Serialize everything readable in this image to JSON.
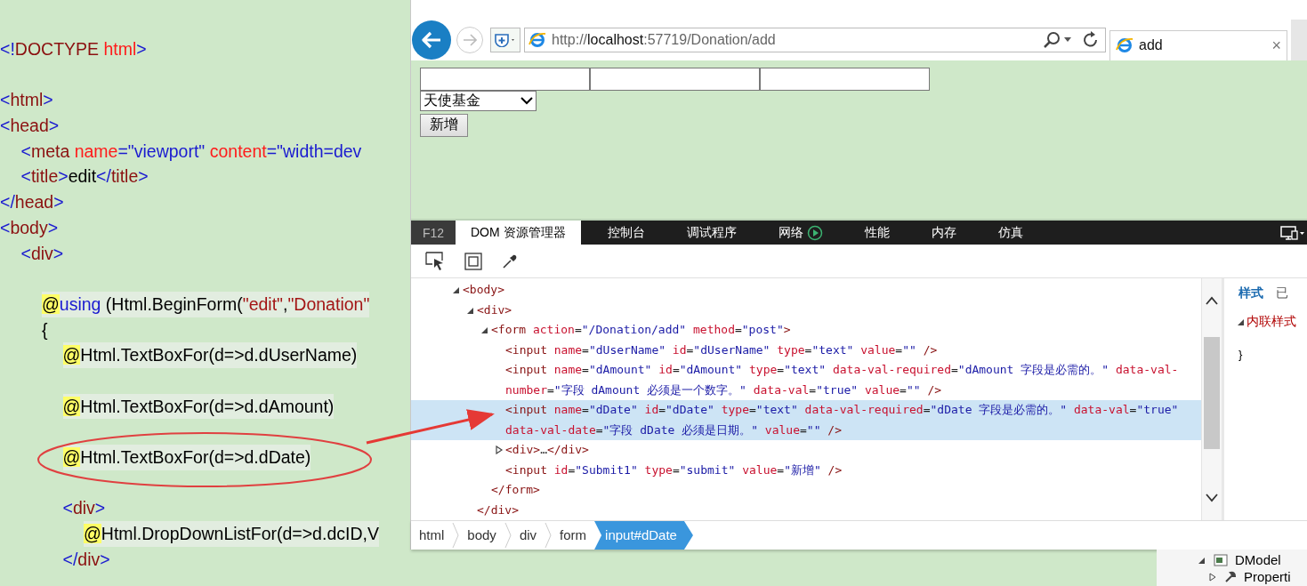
{
  "editor": {
    "lines": [
      {
        "after_blank": false,
        "highlighted": false,
        "tokens": [
          {
            "kind": "punct",
            "text": "<!"
          },
          {
            "kind": "tag",
            "text": "DOCTYPE "
          },
          {
            "kind": "attr",
            "text": "html"
          },
          {
            "kind": "punct",
            "text": ">"
          }
        ]
      },
      {
        "after_blank": true,
        "highlighted": false,
        "tokens": [
          {
            "kind": "punct",
            "text": "<"
          },
          {
            "kind": "tag",
            "text": "html"
          },
          {
            "kind": "punct",
            "text": ">"
          }
        ]
      },
      {
        "after_blank": false,
        "highlighted": false,
        "tokens": [
          {
            "kind": "punct",
            "text": "<"
          },
          {
            "kind": "tag",
            "text": "head"
          },
          {
            "kind": "punct",
            "text": ">"
          }
        ],
        "children": [
          {
            "after_blank": false,
            "highlighted": false,
            "tokens": [
              {
                "kind": "punct",
                "text": "<"
              },
              {
                "kind": "tag",
                "text": "meta "
              },
              {
                "kind": "attr",
                "text": "name"
              },
              {
                "kind": "punct",
                "text": "=\"viewport\" "
              },
              {
                "kind": "attr",
                "text": "content"
              },
              {
                "kind": "punct",
                "text": "=\"width=dev"
              }
            ]
          },
          {
            "after_blank": false,
            "highlighted": false,
            "tokens": [
              {
                "kind": "punct",
                "text": "<"
              },
              {
                "kind": "tag",
                "text": "title"
              },
              {
                "kind": "punct",
                "text": ">"
              },
              {
                "kind": "text",
                "text": "edit"
              },
              {
                "kind": "punct",
                "text": "</"
              },
              {
                "kind": "tag",
                "text": "title"
              },
              {
                "kind": "punct",
                "text": ">"
              }
            ]
          }
        ]
      },
      {
        "after_blank": false,
        "highlighted": false,
        "tokens": [
          {
            "kind": "punct",
            "text": "</"
          },
          {
            "kind": "tag",
            "text": "head"
          },
          {
            "kind": "punct",
            "text": ">"
          }
        ]
      },
      {
        "after_blank": false,
        "highlighted": false,
        "tokens": [
          {
            "kind": "punct",
            "text": "<"
          },
          {
            "kind": "tag",
            "text": "body"
          },
          {
            "kind": "punct",
            "text": ">"
          }
        ],
        "children": [
          {
            "after_blank": false,
            "highlighted": false,
            "tokens": [
              {
                "kind": "punct",
                "text": "<"
              },
              {
                "kind": "tag",
                "text": "div"
              },
              {
                "kind": "punct",
                "text": ">"
              }
            ],
            "children": [
              {
                "after_blank": true,
                "highlighted": true,
                "tokens": [
                  {
                    "kind": "razor",
                    "text": "@"
                  },
                  {
                    "kind": "keyword",
                    "text": "using"
                  },
                  {
                    "kind": "text",
                    "text": " (Html.BeginForm("
                  },
                  {
                    "kind": "string",
                    "text": "\"edit\""
                  },
                  {
                    "kind": "text",
                    "text": ","
                  },
                  {
                    "kind": "string",
                    "text": "\"Donation\""
                  }
                ]
              },
              {
                "after_blank": false,
                "highlighted": false,
                "tokens": [
                  {
                    "kind": "text",
                    "text": "{"
                  }
                ],
                "children": [
                  {
                    "after_blank": false,
                    "highlighted": true,
                    "tokens": [
                      {
                        "kind": "razor",
                        "text": "@"
                      },
                      {
                        "kind": "text",
                        "text": "Html.TextBoxFor(d=>d.dUserName)"
                      }
                    ]
                  },
                  {
                    "after_blank": true,
                    "highlighted": true,
                    "tokens": [
                      {
                        "kind": "razor",
                        "text": "@"
                      },
                      {
                        "kind": "text",
                        "text": "Html.TextBoxFor(d=>d.dAmount)"
                      }
                    ]
                  },
                  {
                    "after_blank": true,
                    "highlighted": true,
                    "tokens": [
                      {
                        "kind": "razor",
                        "text": "@"
                      },
                      {
                        "kind": "text",
                        "text": "Html.TextBoxFor(d=>d.dDate)"
                      }
                    ]
                  },
                  {
                    "after_blank": true,
                    "highlighted": false,
                    "tokens": [
                      {
                        "kind": "punct",
                        "text": "<"
                      },
                      {
                        "kind": "tag",
                        "text": "div"
                      },
                      {
                        "kind": "punct",
                        "text": ">"
                      }
                    ],
                    "children": [
                      {
                        "after_blank": false,
                        "highlighted": true,
                        "tokens": [
                          {
                            "kind": "razor",
                            "text": "@"
                          },
                          {
                            "kind": "text",
                            "text": "Html.DropDownListFor(d=>d.dcID,V"
                          }
                        ]
                      }
                    ]
                  },
                  {
                    "after_blank": false,
                    "highlighted": false,
                    "tokens": [
                      {
                        "kind": "punct",
                        "text": "</"
                      },
                      {
                        "kind": "tag",
                        "text": "div"
                      },
                      {
                        "kind": "punct",
                        "text": ">"
                      }
                    ]
                  }
                ]
              }
            ]
          }
        ]
      }
    ]
  },
  "browser": {
    "address": {
      "scheme": "http://",
      "host": "localhost",
      "path": ":57719/Donation/add"
    },
    "tab": {
      "title": "add",
      "close": "×"
    },
    "page": {
      "text_fields": [
        {
          "kind": "text"
        },
        {
          "kind": "text"
        },
        {
          "kind": "text"
        }
      ],
      "dropdown": {
        "value": "天使基金"
      },
      "submit_button": "新增"
    }
  },
  "devtools": {
    "f12_label": "F12",
    "tabs": [
      {
        "label": "DOM 资源管理器",
        "selected": true
      },
      {
        "label": "控制台",
        "selected": false
      },
      {
        "label": "调试程序",
        "selected": false
      },
      {
        "label": "网络",
        "selected": false,
        "kind": "network"
      },
      {
        "label": "性能",
        "selected": false
      },
      {
        "label": "内存",
        "selected": false
      },
      {
        "label": "仿真",
        "selected": false
      }
    ],
    "dom_tree": [
      {
        "expanded": true,
        "selected": false,
        "tokens": [
          {
            "kind": "tag",
            "text": "<body>"
          }
        ],
        "children": [
          {
            "expanded": true,
            "selected": false,
            "tokens": [
              {
                "kind": "tag",
                "text": "<div>"
              }
            ],
            "end_tokens": [
              {
                "kind": "tag",
                "text": "</div>"
              }
            ],
            "children": [
              {
                "expanded": true,
                "selected": false,
                "tokens": [
                  {
                    "kind": "tag",
                    "text": "<form"
                  },
                  {
                    "kind": "attr",
                    "text": " action"
                  },
                  {
                    "kind": "punct",
                    "text": "="
                  },
                  {
                    "kind": "value",
                    "text": "\"/Donation/add\""
                  },
                  {
                    "kind": "attr",
                    "text": " method"
                  },
                  {
                    "kind": "punct",
                    "text": "="
                  },
                  {
                    "kind": "value",
                    "text": "\"post\""
                  },
                  {
                    "kind": "tag",
                    "text": ">"
                  }
                ],
                "end_tokens": [
                  {
                    "kind": "tag",
                    "text": "</form>"
                  }
                ],
                "children": [
                  {
                    "selected": false,
                    "tokens": [
                      {
                        "kind": "tag",
                        "text": "<input"
                      },
                      {
                        "kind": "attr",
                        "text": " name"
                      },
                      {
                        "kind": "punct",
                        "text": "="
                      },
                      {
                        "kind": "value",
                        "text": "\"dUserName\""
                      },
                      {
                        "kind": "attr",
                        "text": " id"
                      },
                      {
                        "kind": "punct",
                        "text": "="
                      },
                      {
                        "kind": "value",
                        "text": "\"dUserName\""
                      },
                      {
                        "kind": "attr",
                        "text": " type"
                      },
                      {
                        "kind": "punct",
                        "text": "="
                      },
                      {
                        "kind": "value",
                        "text": "\"text\""
                      },
                      {
                        "kind": "attr",
                        "text": " value"
                      },
                      {
                        "kind": "punct",
                        "text": "="
                      },
                      {
                        "kind": "value",
                        "text": "\"\""
                      },
                      {
                        "kind": "tag",
                        "text": " />"
                      }
                    ]
                  },
                  {
                    "selected": false,
                    "tokens": [
                      {
                        "kind": "tag",
                        "text": "<input"
                      },
                      {
                        "kind": "attr",
                        "text": " name"
                      },
                      {
                        "kind": "punct",
                        "text": "="
                      },
                      {
                        "kind": "value",
                        "text": "\"dAmount\""
                      },
                      {
                        "kind": "attr",
                        "text": " id"
                      },
                      {
                        "kind": "punct",
                        "text": "="
                      },
                      {
                        "kind": "value",
                        "text": "\"dAmount\""
                      },
                      {
                        "kind": "attr",
                        "text": " type"
                      },
                      {
                        "kind": "punct",
                        "text": "="
                      },
                      {
                        "kind": "value",
                        "text": "\"text\""
                      },
                      {
                        "kind": "attr",
                        "text": " data-val-required"
                      },
                      {
                        "kind": "punct",
                        "text": "="
                      },
                      {
                        "kind": "value",
                        "text": "\"dAmount 字段是必需的。\""
                      },
                      {
                        "kind": "attr",
                        "text": " data-val-number"
                      },
                      {
                        "kind": "punct",
                        "text": "="
                      },
                      {
                        "kind": "value",
                        "text": "\"字段 dAmount 必须是一个数字。\""
                      },
                      {
                        "kind": "attr",
                        "text": " data-val"
                      },
                      {
                        "kind": "punct",
                        "text": "="
                      },
                      {
                        "kind": "value",
                        "text": "\"true\""
                      },
                      {
                        "kind": "attr",
                        "text": " value"
                      },
                      {
                        "kind": "punct",
                        "text": "="
                      },
                      {
                        "kind": "value",
                        "text": "\"\""
                      },
                      {
                        "kind": "tag",
                        "text": " />"
                      }
                    ]
                  },
                  {
                    "selected": true,
                    "tokens": [
                      {
                        "kind": "tag",
                        "text": "<input"
                      },
                      {
                        "kind": "attr",
                        "text": " name"
                      },
                      {
                        "kind": "punct",
                        "text": "="
                      },
                      {
                        "kind": "value",
                        "text": "\"dDate\""
                      },
                      {
                        "kind": "attr",
                        "text": " id"
                      },
                      {
                        "kind": "punct",
                        "text": "="
                      },
                      {
                        "kind": "value",
                        "text": "\"dDate\""
                      },
                      {
                        "kind": "attr",
                        "text": " type"
                      },
                      {
                        "kind": "punct",
                        "text": "="
                      },
                      {
                        "kind": "value",
                        "text": "\"text\""
                      },
                      {
                        "kind": "attr",
                        "text": " data-val-required"
                      },
                      {
                        "kind": "punct",
                        "text": "="
                      },
                      {
                        "kind": "value",
                        "text": "\"dDate 字段是必需的。\""
                      },
                      {
                        "kind": "attr",
                        "text": " data-val"
                      },
                      {
                        "kind": "punct",
                        "text": "="
                      },
                      {
                        "kind": "value",
                        "text": "\"true\""
                      },
                      {
                        "kind": "attr",
                        "text": " data-val-date"
                      },
                      {
                        "kind": "punct",
                        "text": "="
                      },
                      {
                        "kind": "value",
                        "text": "\"字段 dDate 必须是日期。\""
                      },
                      {
                        "kind": "attr",
                        "text": " value"
                      },
                      {
                        "kind": "punct",
                        "text": "="
                      },
                      {
                        "kind": "value",
                        "text": "\"\""
                      },
                      {
                        "kind": "tag",
                        "text": " />"
                      }
                    ]
                  },
                  {
                    "expanded": false,
                    "selected": false,
                    "tokens": [
                      {
                        "kind": "tag",
                        "text": "<div>"
                      },
                      {
                        "kind": "punct",
                        "text": "…"
                      },
                      {
                        "kind": "tag",
                        "text": "</div>"
                      }
                    ]
                  },
                  {
                    "selected": false,
                    "tokens": [
                      {
                        "kind": "tag",
                        "text": "<input"
                      },
                      {
                        "kind": "attr",
                        "text": " id"
                      },
                      {
                        "kind": "punct",
                        "text": "="
                      },
                      {
                        "kind": "value",
                        "text": "\"Submit1\""
                      },
                      {
                        "kind": "attr",
                        "text": " type"
                      },
                      {
                        "kind": "punct",
                        "text": "="
                      },
                      {
                        "kind": "value",
                        "text": "\"submit\""
                      },
                      {
                        "kind": "attr",
                        "text": " value"
                      },
                      {
                        "kind": "punct",
                        "text": "="
                      },
                      {
                        "kind": "value",
                        "text": "\"新增\""
                      },
                      {
                        "kind": "tag",
                        "text": " />"
                      }
                    ]
                  }
                ]
              }
            ]
          }
        ]
      }
    ],
    "styles_pane": {
      "tabs": [
        {
          "label": "样式",
          "selected": true
        },
        {
          "label": "已",
          "selected": false
        }
      ],
      "section": "内联样式",
      "brace": "}"
    },
    "breadcrumb": [
      {
        "label": "html",
        "selected": false
      },
      {
        "label": "body",
        "selected": false
      },
      {
        "label": "div",
        "selected": false
      },
      {
        "label": "form",
        "selected": false
      },
      {
        "label": "input#dDate",
        "selected": true
      }
    ]
  },
  "solution_explorer": {
    "items": [
      {
        "label": "DModel",
        "expanded": true
      },
      {
        "label": "Properti",
        "expanded": false
      }
    ]
  }
}
